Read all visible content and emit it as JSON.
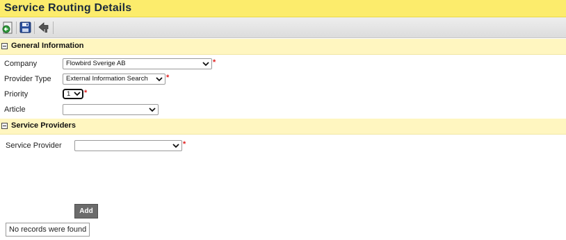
{
  "header": {
    "title": "Service Routing Details"
  },
  "toolbar": {
    "buttons": [
      "back-icon",
      "save-icon",
      "undo-icon"
    ]
  },
  "general": {
    "section_title": "General Information",
    "company_label": "Company",
    "company_value": "Flowbird Sverige AB",
    "provider_type_label": "Provider Type",
    "provider_type_value": "External Information Search",
    "priority_label": "Priority",
    "priority_value": "1",
    "article_label": "Article",
    "article_value": ""
  },
  "providers": {
    "section_title": "Service Providers",
    "service_provider_label": "Service Provider",
    "service_provider_value": "",
    "add_label": "Add",
    "empty_text": "No records were found"
  },
  "required_marker": "*",
  "colors": {
    "title_bar": "#fcec6c",
    "section_bar": "#fff6c0",
    "required": "#e02020"
  }
}
